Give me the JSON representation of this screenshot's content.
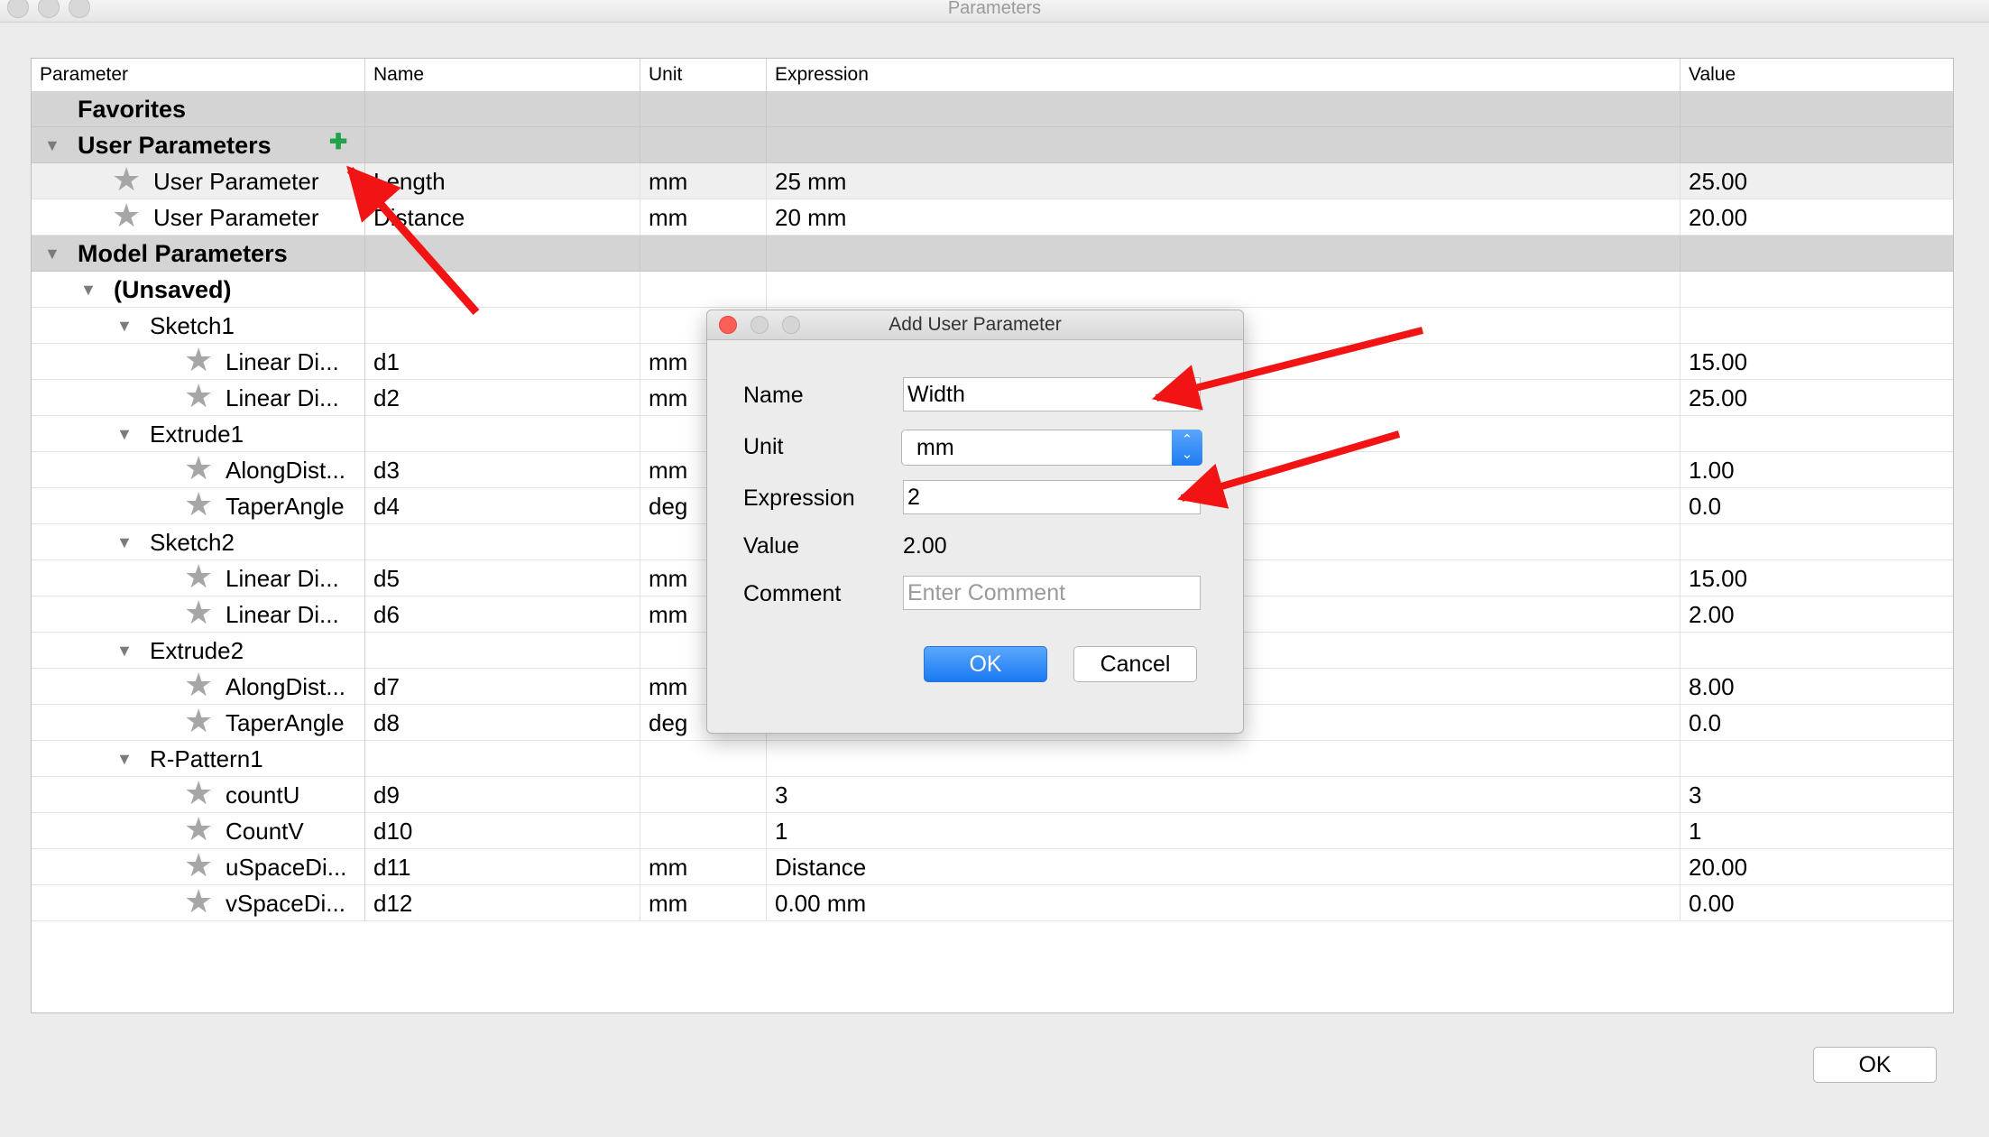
{
  "window": {
    "title": "Parameters"
  },
  "columns": {
    "parameter": "Parameter",
    "name": "Name",
    "unit": "Unit",
    "expression": "Expression",
    "value": "Value"
  },
  "rows": [
    {
      "kind": "group",
      "level": 0,
      "triangle": false,
      "label": "Favorites",
      "name": "",
      "unit": "",
      "expr": "",
      "value": ""
    },
    {
      "kind": "group",
      "level": 0,
      "triangle": true,
      "label": "User Parameters",
      "plus": true,
      "name": "",
      "unit": "",
      "expr": "",
      "value": ""
    },
    {
      "kind": "param",
      "level": 1,
      "star": true,
      "label": "User Parameter",
      "name": "Length",
      "unit": "mm",
      "expr": "25 mm",
      "value": "25.00",
      "selected": true
    },
    {
      "kind": "param",
      "level": 1,
      "star": true,
      "label": "User Parameter",
      "name": "Distance",
      "unit": "mm",
      "expr": "20 mm",
      "value": "20.00"
    },
    {
      "kind": "group",
      "level": 0,
      "triangle": true,
      "label": "Model Parameters",
      "name": "",
      "unit": "",
      "expr": "",
      "value": ""
    },
    {
      "kind": "node",
      "level": 1,
      "triangle": true,
      "bold": true,
      "label": "(Unsaved)",
      "name": "",
      "unit": "",
      "expr": "",
      "value": ""
    },
    {
      "kind": "node",
      "level": 2,
      "triangle": true,
      "label": "Sketch1",
      "name": "",
      "unit": "",
      "expr": "",
      "value": ""
    },
    {
      "kind": "param",
      "level": 3,
      "star": true,
      "label": "Linear Di...",
      "name": "d1",
      "unit": "mm",
      "expr": "",
      "value": "15.00"
    },
    {
      "kind": "param",
      "level": 3,
      "star": true,
      "label": "Linear Di...",
      "name": "d2",
      "unit": "mm",
      "expr": "",
      "value": "25.00"
    },
    {
      "kind": "node",
      "level": 2,
      "triangle": true,
      "label": "Extrude1",
      "name": "",
      "unit": "",
      "expr": "",
      "value": ""
    },
    {
      "kind": "param",
      "level": 3,
      "star": true,
      "label": "AlongDist...",
      "name": "d3",
      "unit": "mm",
      "expr": "",
      "value": "1.00"
    },
    {
      "kind": "param",
      "level": 3,
      "star": true,
      "label": "TaperAngle",
      "name": "d4",
      "unit": "deg",
      "expr": "",
      "value": "0.0"
    },
    {
      "kind": "node",
      "level": 2,
      "triangle": true,
      "label": "Sketch2",
      "name": "",
      "unit": "",
      "expr": "",
      "value": ""
    },
    {
      "kind": "param",
      "level": 3,
      "star": true,
      "label": "Linear Di...",
      "name": "d5",
      "unit": "mm",
      "expr": "",
      "value": "15.00"
    },
    {
      "kind": "param",
      "level": 3,
      "star": true,
      "label": "Linear Di...",
      "name": "d6",
      "unit": "mm",
      "expr": "",
      "value": "2.00"
    },
    {
      "kind": "node",
      "level": 2,
      "triangle": true,
      "label": "Extrude2",
      "name": "",
      "unit": "",
      "expr": "",
      "value": ""
    },
    {
      "kind": "param",
      "level": 3,
      "star": true,
      "label": "AlongDist...",
      "name": "d7",
      "unit": "mm",
      "expr": "",
      "value": "8.00"
    },
    {
      "kind": "param",
      "level": 3,
      "star": true,
      "label": "TaperAngle",
      "name": "d8",
      "unit": "deg",
      "expr": "",
      "value": "0.0"
    },
    {
      "kind": "node",
      "level": 2,
      "triangle": true,
      "label": "R-Pattern1",
      "name": "",
      "unit": "",
      "expr": "",
      "value": ""
    },
    {
      "kind": "param",
      "level": 3,
      "star": true,
      "label": "countU",
      "name": "d9",
      "unit": "",
      "expr": "3",
      "value": "3"
    },
    {
      "kind": "param",
      "level": 3,
      "star": true,
      "label": "CountV",
      "name": "d10",
      "unit": "",
      "expr": "1",
      "value": "1"
    },
    {
      "kind": "param",
      "level": 3,
      "star": true,
      "label": "uSpaceDi...",
      "name": "d11",
      "unit": "mm",
      "expr": "Distance",
      "value": "20.00"
    },
    {
      "kind": "param",
      "level": 3,
      "star": true,
      "label": "vSpaceDi...",
      "name": "d12",
      "unit": "mm",
      "expr": "0.00 mm",
      "value": "0.00"
    }
  ],
  "dialog": {
    "title": "Add User Parameter",
    "name_label": "Name",
    "name_value": "Width",
    "unit_label": "Unit",
    "unit_value": "mm",
    "expression_label": "Expression",
    "expression_value": "2",
    "value_label": "Value",
    "value_value": "2.00",
    "comment_label": "Comment",
    "comment_placeholder": "Enter Comment",
    "ok_label": "OK",
    "cancel_label": "Cancel"
  },
  "footer": {
    "ok_label": "OK"
  },
  "icons": {
    "star": "star-icon",
    "triangle": "disclosure-triangle-icon",
    "plus": "add-plus-icon",
    "arrow": "red-arrow-annotation"
  },
  "colors": {
    "accent": "#1f7cf2",
    "annotation": "#f21414",
    "plus": "#21a34a",
    "group_row": "#d4d4d4"
  }
}
